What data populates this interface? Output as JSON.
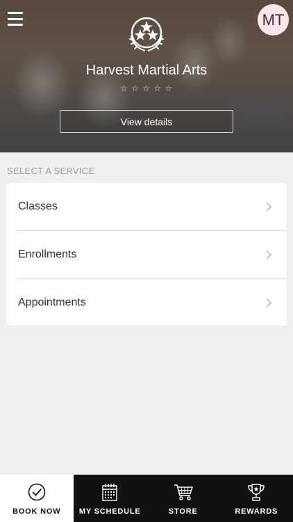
{
  "header": {
    "business_name": "Harvest Martial Arts",
    "avatar_initials": "MT",
    "rating_stars": [
      "☆",
      "☆",
      "☆",
      "☆",
      "☆"
    ],
    "view_details_label": "View details",
    "logo_icon": "stars-laurel-icon",
    "menu_icon": "hamburger-menu-icon"
  },
  "services": {
    "section_label": "SELECT A SERVICE",
    "items": [
      {
        "label": "Classes"
      },
      {
        "label": "Enrollments"
      },
      {
        "label": "Appointments"
      }
    ]
  },
  "tabbar": {
    "tabs": [
      {
        "label": "BOOK NOW",
        "icon": "check-circle-icon",
        "active": true
      },
      {
        "label": "MY SCHEDULE",
        "icon": "calendar-icon",
        "active": false
      },
      {
        "label": "STORE",
        "icon": "cart-icon",
        "active": false
      },
      {
        "label": "REWARDS",
        "icon": "trophy-icon",
        "active": false
      }
    ]
  },
  "colors": {
    "background": "#f0f0f0",
    "tabbar_background": "#111111",
    "active_tab_background": "#ffffff",
    "avatar_background": "#fde3ea"
  }
}
